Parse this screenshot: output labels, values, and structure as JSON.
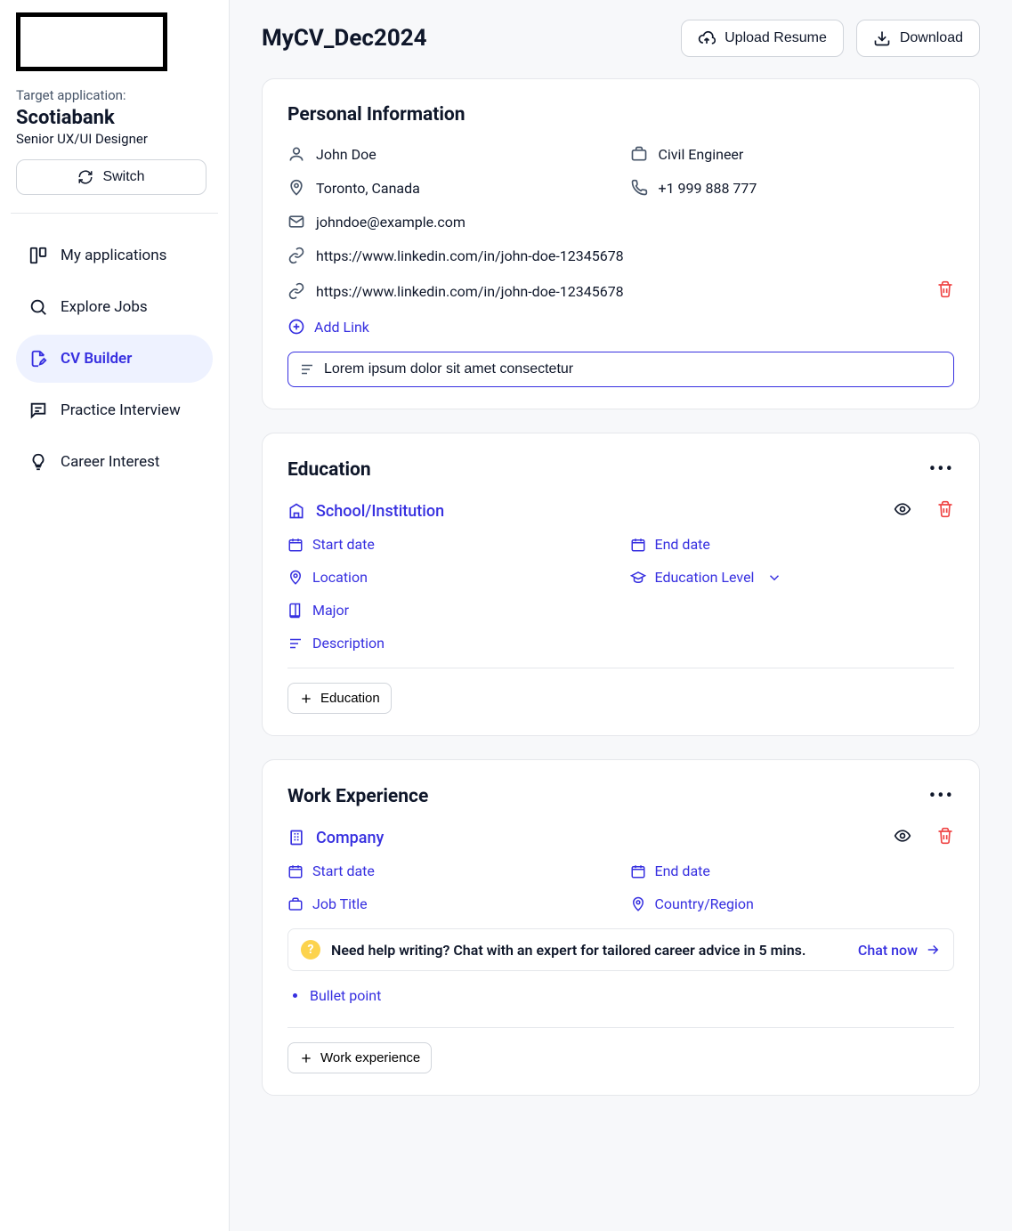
{
  "sidebar": {
    "target_label": "Target application:",
    "company": "Scotiabank",
    "role": "Senior UX/UI Designer",
    "switch_label": "Switch",
    "nav": [
      {
        "label": "My applications"
      },
      {
        "label": "Explore Jobs"
      },
      {
        "label": "CV Builder"
      },
      {
        "label": "Practice Interview"
      },
      {
        "label": "Career Interest"
      }
    ]
  },
  "header": {
    "title": "MyCV_Dec2024",
    "upload_label": "Upload Resume",
    "download_label": "Download"
  },
  "personal": {
    "title": "Personal Information",
    "name": "John Doe",
    "job_title": "Civil Engineer",
    "location": "Toronto, Canada",
    "phone": "+1 999 888 777",
    "email": "johndoe@example.com",
    "link1": "https://www.linkedin.com/in/john-doe-12345678",
    "link2": "https://www.linkedin.com/in/john-doe-12345678",
    "add_link_label": "Add Link",
    "desc_value": "Lorem ipsum dolor sit amet consectetur"
  },
  "education": {
    "title": "Education",
    "school_label": "School/Institution",
    "start_label": "Start date",
    "end_label": "End date",
    "location_label": "Location",
    "level_label": "Education Level",
    "major_label": "Major",
    "desc_label": "Description",
    "add_label": "Education"
  },
  "work": {
    "title": "Work Experience",
    "company_label": "Company",
    "start_label": "Start date",
    "end_label": "End date",
    "jobtitle_label": "Job Title",
    "country_label": "Country/Region",
    "help_text": "Need help writing? Chat with an expert for tailored career advice in 5 mins.",
    "chat_now_label": "Chat now",
    "bullet_label": "Bullet point",
    "add_label": "Work experience"
  }
}
